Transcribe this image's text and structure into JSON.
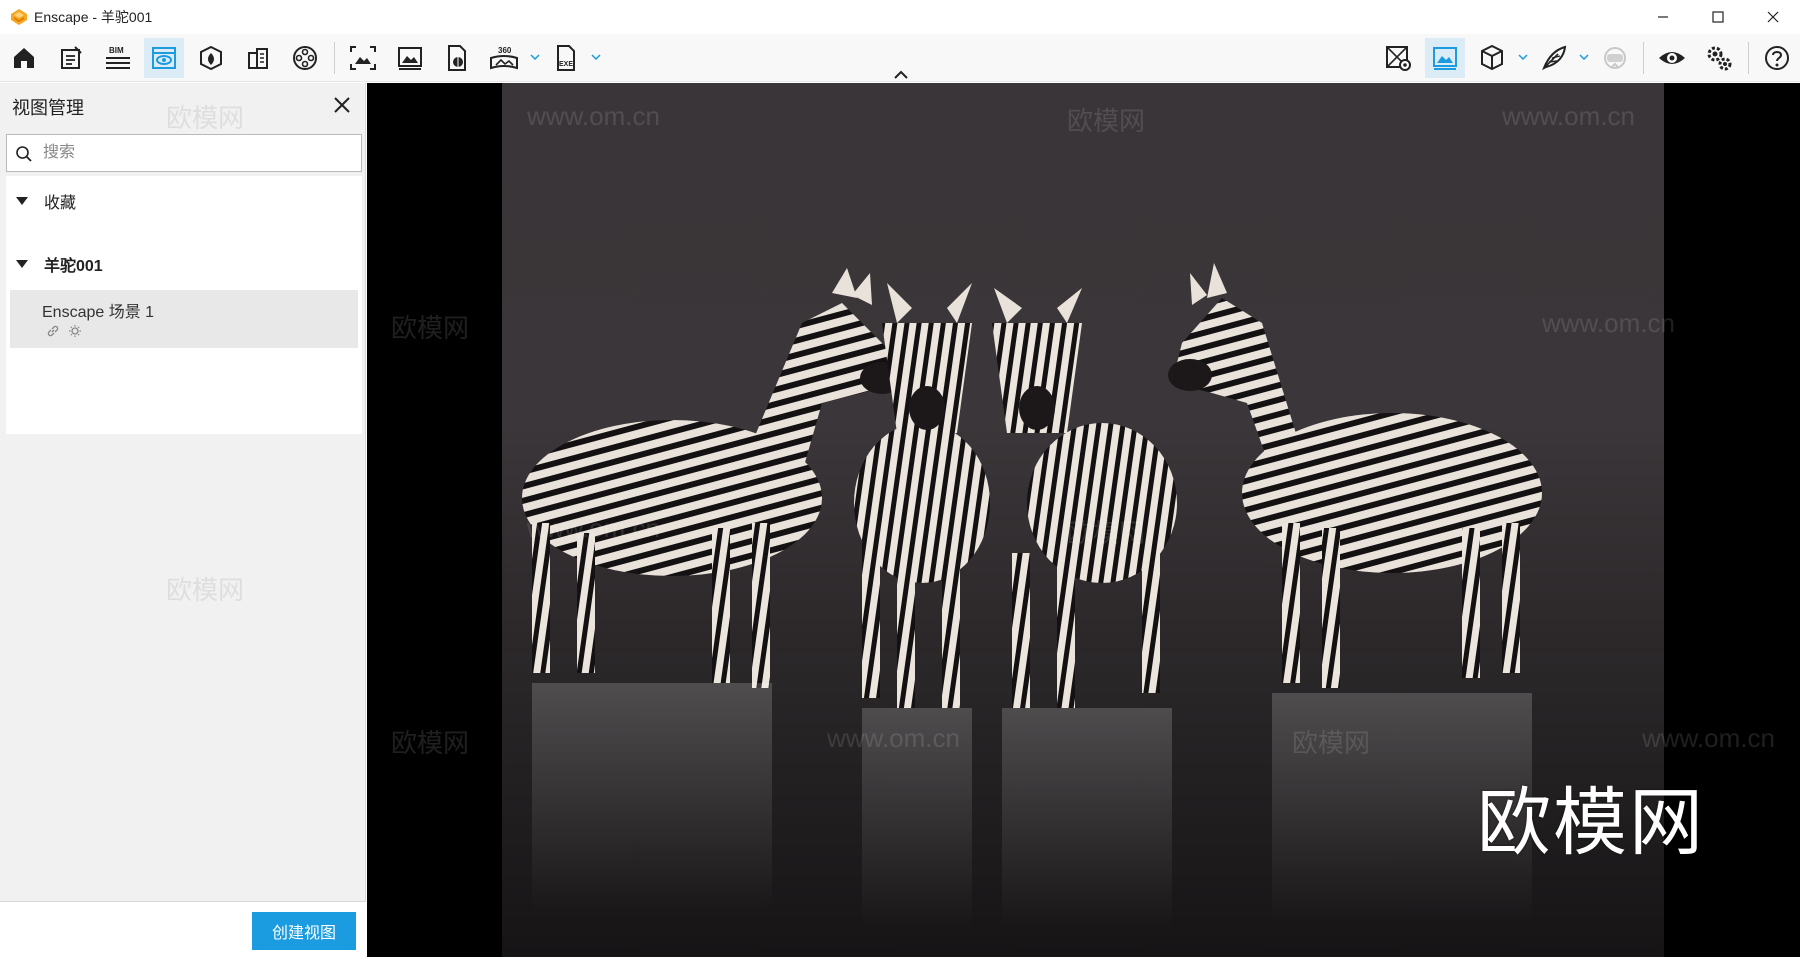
{
  "window": {
    "title": "Enscape - 羊驼001",
    "controls": [
      "minimize-icon",
      "maximize-icon",
      "close-icon"
    ]
  },
  "toolbar": {
    "left_icons": [
      "home-icon",
      "notes-icon",
      "bim-icon",
      "visual-settings-icon",
      "asset-library-icon",
      "site-context-icon",
      "video-editor-icon",
      "screenshot-icon",
      "batch-render-icon",
      "export-web-icon",
      "panorama-360-icon",
      "export-exe-icon"
    ],
    "bim_label": "BIM",
    "pano_label": "360",
    "exe_label": "EXE",
    "right_icons": [
      "view-management-icon",
      "views-icon",
      "cube-icon",
      "feather-icon",
      "vr-headset-icon",
      "eye-icon",
      "settings-icon",
      "help-icon"
    ]
  },
  "panel": {
    "title": "视图管理",
    "search_placeholder": "搜索",
    "groups": [
      {
        "label": "收藏",
        "expanded": true
      },
      {
        "label": "羊驼001",
        "expanded": true
      }
    ],
    "views": [
      {
        "name": "Enscape 场景 1"
      }
    ],
    "create_button": "创建视图"
  },
  "viewport": {
    "watermarks": [
      "欧模网",
      "www.om.cn"
    ],
    "big_watermark": "欧模网"
  },
  "colors": {
    "accent": "#1b9be0",
    "panel_bg": "#f1f1f1",
    "active_tool_bg": "#dcecf7"
  }
}
